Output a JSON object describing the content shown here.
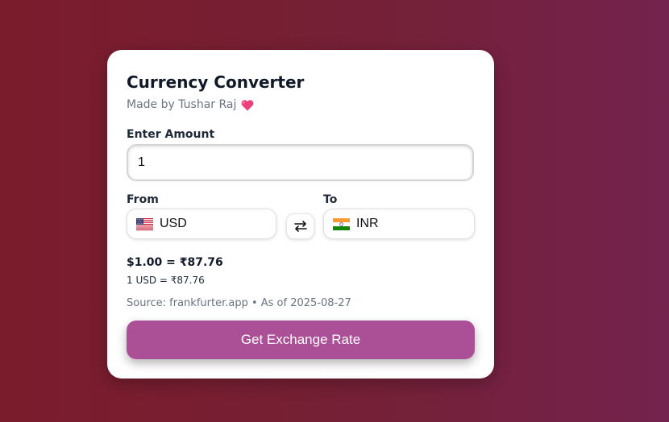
{
  "card": {
    "title": "Currency Converter",
    "subtitle": "Made by Tushar Raj",
    "subtitle_icon": "heart-icon",
    "subtitle_icon_color": "#ec407a"
  },
  "amount": {
    "label": "Enter Amount",
    "value": "1"
  },
  "from": {
    "label": "From",
    "currency": "USD",
    "flag_icon": "us-flag-icon"
  },
  "swap": {
    "icon": "swap-arrows-icon"
  },
  "to": {
    "label": "To",
    "currency": "INR",
    "flag_icon": "india-flag-icon"
  },
  "result": {
    "main": "$1.00 = ₹87.76",
    "rate": "1 USD = ₹87.76",
    "source": "Source: frankfurter.app • As of 2025-08-27"
  },
  "action": {
    "button_label": "Get Exchange Rate",
    "button_color": "#ab4f96"
  },
  "theme": {
    "background_start": "#7b1c2c",
    "background_end": "#73234d"
  }
}
